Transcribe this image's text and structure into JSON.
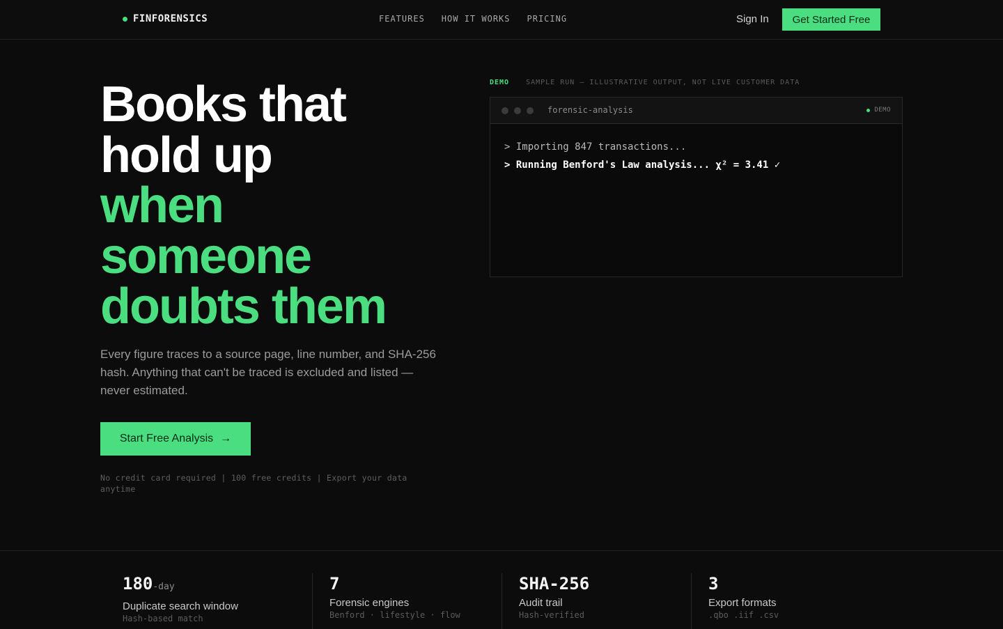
{
  "nav": {
    "brand": "FINFORENSICS",
    "links": [
      "FEATURES",
      "HOW IT WORKS",
      "PRICING"
    ],
    "sign_in": "Sign In",
    "cta": "Get Started Free"
  },
  "hero": {
    "headline_white": [
      "Books that",
      "hold up"
    ],
    "headline_green": [
      "when",
      "someone",
      "doubts them"
    ],
    "subtext": "Every figure traces to a source page, line number, and SHA-256 hash. Anything that can't be traced is excluded and listed — never estimated.",
    "cta": "Start Free Analysis",
    "fineprint": "No credit card required  |  100 free credits  |  Export your data anytime"
  },
  "demo": {
    "tag": "DEMO",
    "description": "SAMPLE RUN — ILLUSTRATIVE OUTPUT, NOT LIVE CUSTOMER DATA",
    "window_title": "forensic-analysis",
    "badge": "DEMO",
    "lines": [
      "> Importing 847 transactions...",
      "> Running Benford's Law analysis... χ² = 3.41 ✓"
    ]
  },
  "stats": [
    {
      "value": "180",
      "unit": "-day",
      "label": "Duplicate search window",
      "sub": "Hash-based match"
    },
    {
      "value": "7",
      "unit": "",
      "label": "Forensic engines",
      "sub": "Benford · lifestyle · flow"
    },
    {
      "value": "SHA-256",
      "unit": "",
      "label": "Audit trail",
      "sub": "Hash-verified"
    },
    {
      "value": "3",
      "unit": "",
      "label": "Export formats",
      "sub": ".qbo .iif .csv"
    }
  ],
  "colors": {
    "accent": "#4ade80",
    "background": "#0b0c0b"
  },
  "icons": {
    "cta_arrow": "arrow-right-icon",
    "status_dot": "status-dot-icon"
  }
}
